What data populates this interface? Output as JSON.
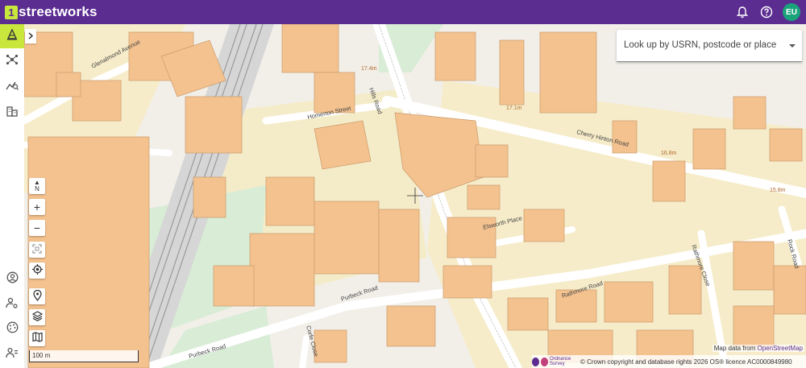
{
  "app": {
    "logo_mark": "1",
    "logo_text": "streetworks"
  },
  "topbar": {
    "icons": [
      "bell-icon",
      "help-icon"
    ],
    "avatar_initials": "EU",
    "avatar_color": "#1aa37a",
    "brand_color": "#5b2d91"
  },
  "sidebar": {
    "top_items": [
      "cone-icon",
      "network-icon",
      "analytics-icon",
      "buildings-icon"
    ],
    "bottom_items": [
      "account-icon",
      "user-settings-icon",
      "palette-icon",
      "team-icon"
    ],
    "active_item": "cone-icon",
    "accent_color": "#c8e63c"
  },
  "search": {
    "placeholder": "Look up by USRN, postcode or place"
  },
  "map_controls": {
    "north": "N",
    "zoom_in": "+",
    "zoom_out": "−"
  },
  "map": {
    "scale_label": "100 m",
    "street_labels": [
      "Glenalmond Avenue",
      "Homerton Street",
      "Hills Road",
      "Cherry Hinton Road",
      "Elsworth Place",
      "Purbeck Road",
      "Rathmore Road",
      "Rathmore Close",
      "Rock Road",
      "Corfe Close"
    ],
    "heights": [
      "17.4m",
      "17.1m",
      "16.8m",
      "15.8m"
    ]
  },
  "attribution": {
    "osm_prefix": "Map data from ",
    "osm_link": "OpenStreetMap",
    "os_logo_text": "Ordnance Survey",
    "os_text": "© Crown copyright and database rights 2026 OS® licence AC0000849980"
  }
}
